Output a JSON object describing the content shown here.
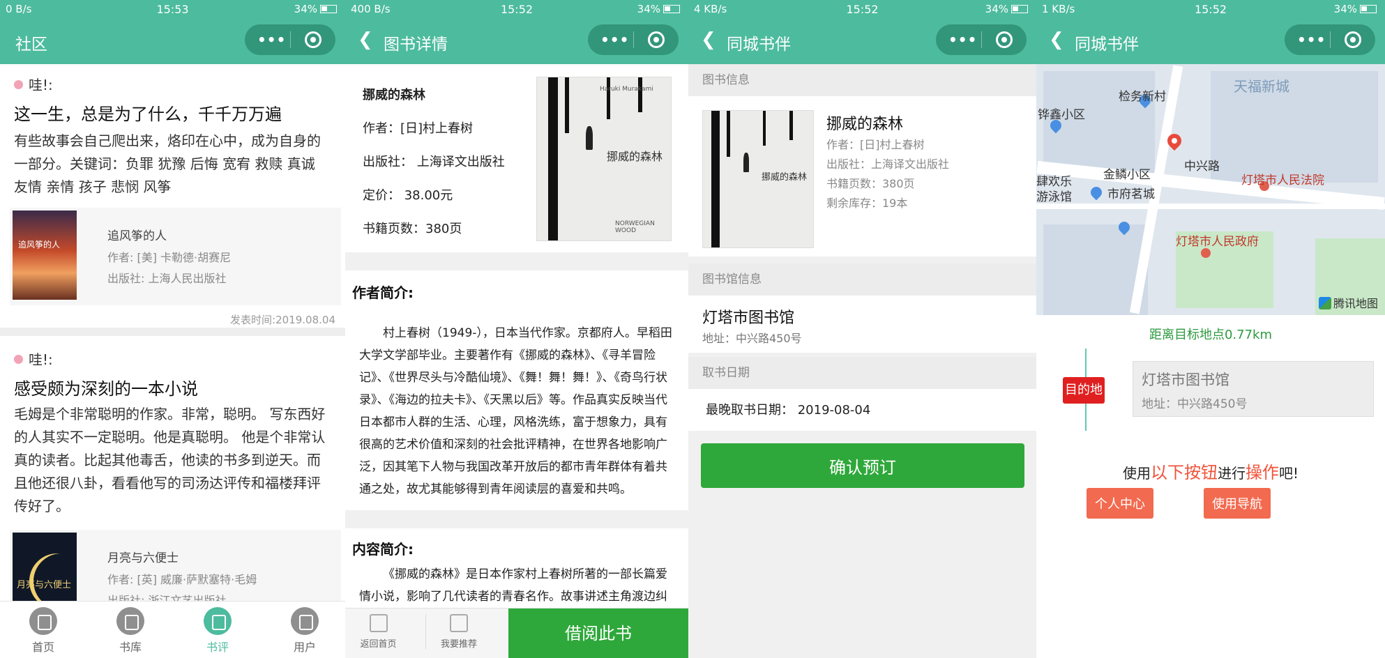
{
  "panel1": {
    "status": {
      "left": "0 B/s",
      "time": "15:53",
      "right": "34%"
    },
    "nav_title": "社区",
    "posts": [
      {
        "wa": "哇!:",
        "title": "这一生，总是为了什么，千千万万遍",
        "body": "有些故事会自己爬出来，烙印在心中，成为自身的一部分。关键词：负罪 犹豫 后悔 宽宥 救赎 真诚 友情 亲情 孩子 悲悯 风筝",
        "book_title": "追风筝的人",
        "book_author": "作者: [美] 卡勒德·胡赛尼",
        "book_publisher": "出版社: 上海人民出版社",
        "cover_text": "追风筝的人",
        "time": "发表时间:2019.08.04"
      },
      {
        "wa": "哇!:",
        "title": "感受颇为深刻的一本小说",
        "body": "毛姆是个非常聪明的作家。非常，聪明。 写东西好的人其实不一定聪明。他是真聪明。 他是个非常认真的读者。比起其他毒舌，他读的书多到逆天。而且他还很八卦，看看他写的司汤达评传和福楼拜评传好了。",
        "book_title": "月亮与六便士",
        "book_author": "作者: [英] 威廉·萨默塞特·毛姆",
        "book_publisher": "出版社: 浙江文艺出版社",
        "cover_text": "月亮与六便士"
      }
    ],
    "tabs": [
      {
        "label": "首页"
      },
      {
        "label": "书库"
      },
      {
        "label": "书评"
      },
      {
        "label": "用户"
      }
    ]
  },
  "panel2": {
    "status": {
      "left": "400 B/s",
      "time": "15:52",
      "right": "34%"
    },
    "nav_title": "图书详情",
    "book": {
      "title": "挪威的森林",
      "author": "作者：[日]村上春树",
      "publisher": "出版社： 上海译文出版社",
      "price": "定价： 38.00元",
      "pages": "书籍页数：380页",
      "cover_title": "挪威的森林",
      "cover_en": "NORWEGIAN WOOD",
      "cover_author": "Haruki Murakami"
    },
    "author_intro_h": "作者简介:",
    "author_intro": "村上春树（1949-），日本当代作家。京都府人。早稻田大学文学部毕业。主要著作有《挪威的森林》、《寻羊冒险记》、《世界尽头与冷酷仙境》、《舞！舞！舞！》、《奇鸟行状录》、《海边的拉夫卡》、《天黑以后》等。作品真实反映当代日本都市人群的生活、心理，风格洗练，富于想象力，具有很高的艺术价值和深刻的社会批评精神，在世界各地影响广泛，因其笔下人物与我国改革开放后的都市青年群体有着共通之处，故尤其能够得到青年阅读层的喜爱和共鸣。",
    "content_intro_h": "内容简介:",
    "content_intro": "《挪威的森林》是日本作家村上春树所著的一部长篇爱情小说，影响了几代读者的青春名作。故事讲述主角渡边纠缠",
    "bottom": {
      "home": "返回首页",
      "recommend": "我要推荐",
      "borrow": "借阅此书"
    }
  },
  "panel3": {
    "status": {
      "left": "4 KB/s",
      "time": "15:52",
      "right": "34%"
    },
    "nav_title": "同城书伴",
    "book_info_h": "图书信息",
    "book": {
      "title": "挪威的森林",
      "author": "作者：[日]村上春树",
      "publisher": "出版社：上海译文出版社",
      "pages": "书籍页数：380页",
      "stock": "剩余库存：19本",
      "cover_title": "挪威的森林"
    },
    "library_info_h": "图书馆信息",
    "library_name": "灯塔市图书馆",
    "library_addr": "地址：中兴路450号",
    "pickup_h": "取书日期",
    "deadline": "最晚取书日期：  2019-08-04",
    "confirm": "确认预订"
  },
  "panel4": {
    "status": {
      "left": "1 KB/s",
      "time": "15:52",
      "right": "34%"
    },
    "nav_title": "同城书伴",
    "map_labels": {
      "tianfu": "天福新城",
      "jianwu": "检务新村",
      "huaxin": "铧鑫小区",
      "zhongxing": "中兴路",
      "court": "灯塔市人民法院",
      "huanle": "肆欢乐",
      "swim": "游泳馆",
      "jinlin": "金鳞小区",
      "fufu": "市府茗城",
      "gov": "灯塔市人民政府",
      "tencent": "腾讯地图"
    },
    "distance": "距离目标地点0.77km",
    "dest_tag": "目的地",
    "dest_name": "灯塔市图书馆",
    "dest_addr": "地址：中兴路450号",
    "prompt_pre": "使用",
    "prompt_hl1": "以下按钮",
    "prompt_mid": "进行",
    "prompt_hl2": "操作",
    "prompt_post": "吧!",
    "btn_center": "个人中心",
    "btn_nav": "使用导航"
  }
}
